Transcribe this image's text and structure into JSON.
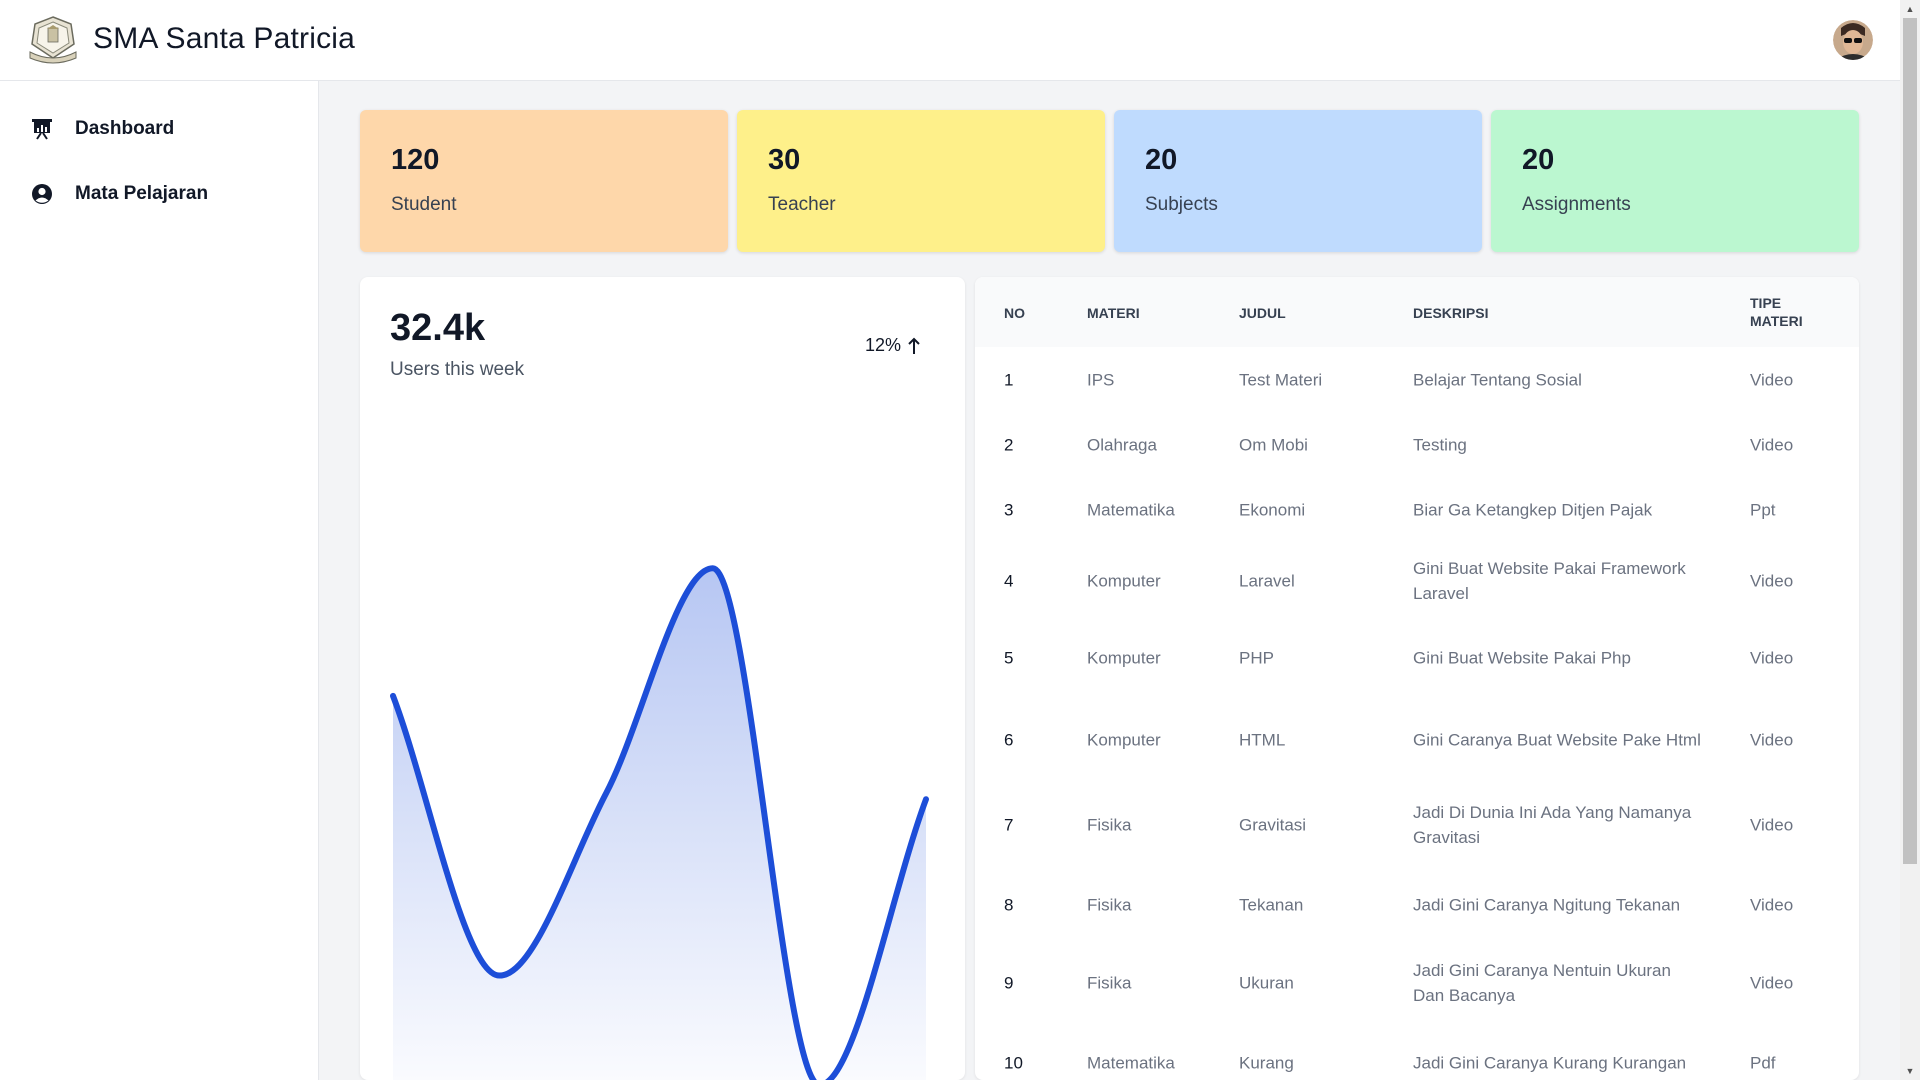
{
  "header": {
    "title": "SMA Santa Patricia",
    "logo_icon": "school-crest-icon",
    "avatar_icon": "user-avatar"
  },
  "sidebar": {
    "items": [
      {
        "label": "Dashboard",
        "icon": "presentation-chart-icon"
      },
      {
        "label": "Mata Pelajaran",
        "icon": "user-circle-icon"
      }
    ]
  },
  "stats": [
    {
      "value": "120",
      "label": "Student",
      "color": "#fed7aa"
    },
    {
      "value": "30",
      "label": "Teacher",
      "color": "#fef08a"
    },
    {
      "value": "20",
      "label": "Subjects",
      "color": "#bfdbfe"
    },
    {
      "value": "20",
      "label": "Assignments",
      "color": "#bbf7d0"
    }
  ],
  "users_widget": {
    "value": "32.4k",
    "subtitle": "Users this week",
    "trend": "12%",
    "trend_icon": "arrow-up-icon"
  },
  "chart_data": {
    "type": "area",
    "title": "",
    "xlabel": "",
    "ylabel": "",
    "color": "#1d4ed8",
    "series": [
      {
        "values": [
          64,
          18,
          48,
          85,
          0,
          47
        ]
      }
    ],
    "ylim": [
      0,
      100
    ],
    "grid": false,
    "legend": "none"
  },
  "table": {
    "headers": [
      "NO",
      "MATERI",
      "JUDUL",
      "DESKRIPSI",
      "TIPE MATERI"
    ],
    "rows": [
      {
        "no": "1",
        "materi": "IPS",
        "judul": "Test Materi",
        "deskripsi": "Belajar Tentang Sosial",
        "tipe": "Video"
      },
      {
        "no": "2",
        "materi": "Olahraga",
        "judul": "Om Mobi",
        "deskripsi": "Testing",
        "tipe": "Video"
      },
      {
        "no": "3",
        "materi": "Matematika",
        "judul": "Ekonomi",
        "deskripsi": "Biar Ga Ketangkep Ditjen Pajak",
        "tipe": "Ppt"
      },
      {
        "no": "4",
        "materi": "Komputer",
        "judul": "Laravel",
        "deskripsi": "Gini Buat Website Pakai Framework Laravel",
        "tipe": "Video"
      },
      {
        "no": "5",
        "materi": "Komputer",
        "judul": "PHP",
        "deskripsi": "Gini Buat Website Pakai Php",
        "tipe": "Video"
      },
      {
        "no": "6",
        "materi": "Komputer",
        "judul": "HTML",
        "deskripsi": "Gini Caranya Buat Website Pake Html",
        "tipe": "Video"
      },
      {
        "no": "7",
        "materi": "Fisika",
        "judul": "Gravitasi",
        "deskripsi": "Jadi Di Dunia Ini Ada Yang Namanya Gravitasi",
        "tipe": "Video"
      },
      {
        "no": "8",
        "materi": "Fisika",
        "judul": "Tekanan",
        "deskripsi": "Jadi Gini Caranya Ngitung Tekanan",
        "tipe": "Video"
      },
      {
        "no": "9",
        "materi": "Fisika",
        "judul": "Ukuran",
        "deskripsi": "Jadi Gini Caranya Nentuin Ukuran Dan Bacanya",
        "tipe": "Video"
      },
      {
        "no": "10",
        "materi": "Matematika",
        "judul": "Kurang",
        "deskripsi": "Jadi Gini Caranya Kurang Kurangan",
        "tipe": "Pdf"
      }
    ]
  }
}
